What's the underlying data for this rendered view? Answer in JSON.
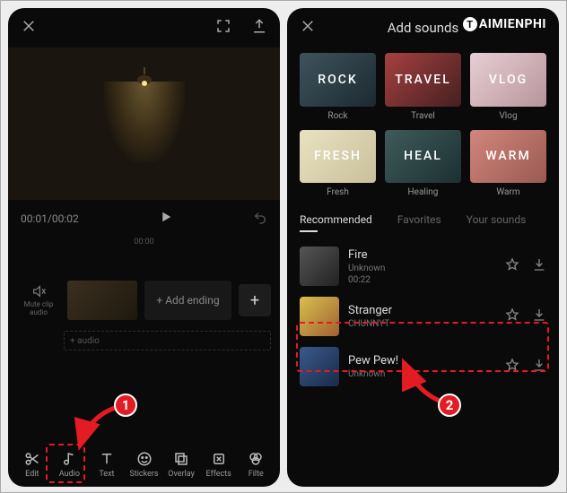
{
  "watermark": "AIMIENPHI",
  "left": {
    "timecode": "00:01/00:02",
    "ruler_label": "00:00",
    "mute_label": "Mute clip audio",
    "add_ending": "+  Add ending",
    "add_audio": "+ audio",
    "toolbar": [
      {
        "name": "edit",
        "label": "Edit",
        "icon": "scissors"
      },
      {
        "name": "audio",
        "label": "Audio",
        "icon": "music-note"
      },
      {
        "name": "text",
        "label": "Text",
        "icon": "text"
      },
      {
        "name": "stickers",
        "label": "Stickers",
        "icon": "sticker"
      },
      {
        "name": "overlay",
        "label": "Overlay",
        "icon": "overlay"
      },
      {
        "name": "effects",
        "label": "Effects",
        "icon": "effects"
      },
      {
        "name": "filters",
        "label": "Filte",
        "icon": "filters"
      }
    ]
  },
  "right": {
    "title": "Add sounds",
    "categories": [
      {
        "overlay": "ROCK",
        "label": "Rock",
        "bg": "linear-gradient(135deg,#3f535d,#1c2a30)"
      },
      {
        "overlay": "TRAVEL",
        "label": "Travel",
        "bg": "linear-gradient(135deg,#a64040,#452020)"
      },
      {
        "overlay": "VLOG",
        "label": "Vlog",
        "bg": "linear-gradient(135deg,#e8cfd5,#b8949c)"
      },
      {
        "overlay": "FRESH",
        "label": "Fresh",
        "bg": "linear-gradient(135deg,#e9e2c1,#c9c09a)"
      },
      {
        "overlay": "HEAL",
        "label": "Healing",
        "bg": "linear-gradient(135deg,#3f5a5a,#1c3131)"
      },
      {
        "overlay": "WARM",
        "label": "Warm",
        "bg": "linear-gradient(135deg,#d1867c,#9a5a52)"
      }
    ],
    "tabs": [
      {
        "name": "recommended",
        "label": "Recommended",
        "active": true
      },
      {
        "name": "favorites",
        "label": "Favorites",
        "active": false
      },
      {
        "name": "your-sounds",
        "label": "Your sounds",
        "active": false
      }
    ],
    "tracks": [
      {
        "title": "Fire",
        "artist": "Unknown",
        "duration": "00:22",
        "thumb_bg": "linear-gradient(135deg,#555,#222)"
      },
      {
        "title": "Stranger",
        "artist": "CHUNNYT",
        "duration": "",
        "thumb_bg": "linear-gradient(135deg,#d8c050,#a06030)"
      },
      {
        "title": "Pew Pew!",
        "artist": "Unknown",
        "duration": "",
        "thumb_bg": "linear-gradient(135deg,#3a5a8a,#1a2a4a)"
      }
    ]
  }
}
